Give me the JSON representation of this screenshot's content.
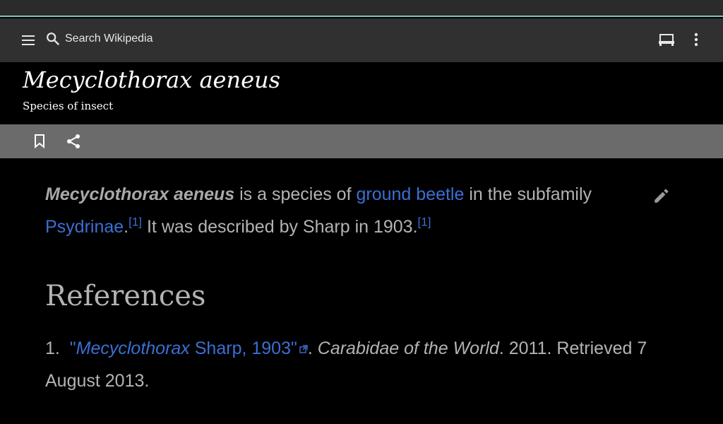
{
  "toolbar": {
    "search_placeholder": "Search Wikipedia",
    "menu_icon": "hamburger-menu-icon",
    "search_icon": "search-icon",
    "reading_icon": "reading-lists-icon",
    "overflow_icon": "more-vertical-icon"
  },
  "article": {
    "title": "Mecyclothorax aeneus",
    "description": "Species of insect"
  },
  "actions": {
    "bookmark_icon": "bookmark-icon",
    "share_icon": "share-icon"
  },
  "body": {
    "subject": "Mecyclothorax aeneus",
    "text1": " is a species of ",
    "link1": "ground beetle",
    "text2": " in the subfamily ",
    "link2": "Psydrinae",
    "text3": ".",
    "cite1": "[1]",
    "text4": " It was described by Sharp in 1903.",
    "cite2": "[1]",
    "edit_icon": "edit-pencil-icon"
  },
  "references": {
    "heading": "References",
    "items": [
      {
        "number": "1.",
        "quote_open": "\"",
        "link_italic": "Mecyclothorax",
        "link_rest": " Sharp, 1903",
        "quote_close": "\"",
        "sep": ". ",
        "source": "Carabidae of the World",
        "tail": ". 2011. Retrieved 7 August 2013."
      }
    ]
  },
  "colors": {
    "link": "#3a6fd4",
    "text": "#b3b3b3",
    "toolbar_bg": "#303030",
    "action_bg": "#6b6b6b",
    "accent_line": "#7fc4c0"
  }
}
